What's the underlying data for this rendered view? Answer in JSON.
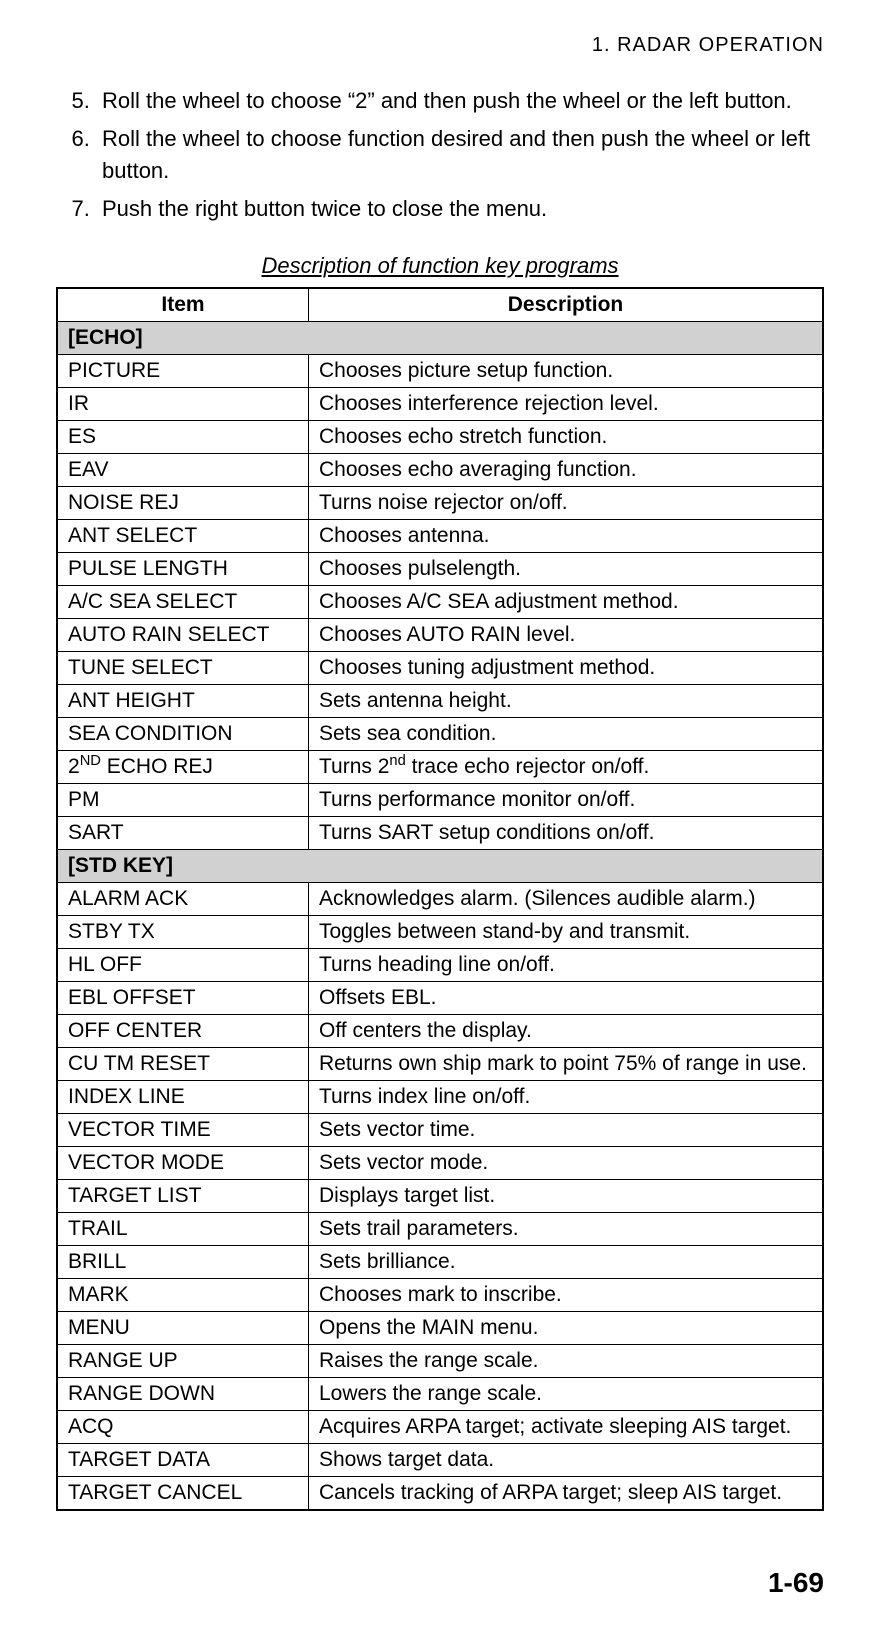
{
  "runningHead": "1.  RADAR  OPERATION",
  "steps": [
    "Roll the wheel to choose “2” and then push the wheel or the left button.",
    "Roll the wheel to choose function desired and then push the wheel or left button.",
    "Push the right button twice to close the menu."
  ],
  "stepStart": "5",
  "tableCaption": "Description of function key programs",
  "columns": {
    "item": "Item",
    "desc": "Description"
  },
  "sections": [
    {
      "category": "[ECHO]",
      "rows": [
        {
          "item": "PICTURE",
          "desc": "Chooses picture setup function."
        },
        {
          "item": "IR",
          "desc": "Chooses interference rejection level."
        },
        {
          "item": "ES",
          "desc": "Chooses echo stretch function."
        },
        {
          "item": "EAV",
          "desc": "Chooses echo averaging function."
        },
        {
          "item": "NOISE REJ",
          "desc": "Turns noise rejector on/off."
        },
        {
          "item": "ANT SELECT",
          "desc": "Chooses antenna."
        },
        {
          "item": "PULSE LENGTH",
          "desc": "Chooses pulselength."
        },
        {
          "item": "A/C SEA SELECT",
          "desc": "Chooses A/C SEA adjustment method."
        },
        {
          "item": "AUTO RAIN SELECT",
          "desc": "Chooses AUTO RAIN level."
        },
        {
          "item": "TUNE SELECT",
          "desc": "Chooses tuning adjustment method."
        },
        {
          "item": "ANT HEIGHT",
          "desc": "Sets antenna height."
        },
        {
          "item": "SEA CONDITION",
          "desc": "Sets sea condition."
        },
        {
          "item_html": "2<sup class=\"small\">ND</sup> ECHO REJ",
          "desc_html": "Turns 2<sup class=\"small\">nd</sup> trace echo rejector on/off."
        },
        {
          "item": "PM",
          "desc": "Turns performance monitor on/off."
        },
        {
          "item": "SART",
          "desc": "Turns SART setup conditions on/off."
        }
      ]
    },
    {
      "category": "[STD KEY]",
      "rows": [
        {
          "item": "ALARM ACK",
          "desc": "Acknowledges alarm. (Silences audible alarm.)"
        },
        {
          "item": "STBY TX",
          "desc": "Toggles between stand-by and transmit."
        },
        {
          "item": "HL OFF",
          "desc": "Turns heading line on/off."
        },
        {
          "item": "EBL OFFSET",
          "desc": "Offsets EBL."
        },
        {
          "item": "OFF CENTER",
          "desc": "Off centers the display."
        },
        {
          "item": "CU TM RESET",
          "desc": "Returns own ship mark to point 75% of range in use."
        },
        {
          "item": "INDEX LINE",
          "desc": "Turns index line on/off."
        },
        {
          "item": "VECTOR TIME",
          "desc": "Sets vector time."
        },
        {
          "item": "VECTOR MODE",
          "desc": "Sets vector mode."
        },
        {
          "item": "TARGET LIST",
          "desc": "Displays target list."
        },
        {
          "item": "TRAIL",
          "desc": "Sets trail parameters."
        },
        {
          "item": "BRILL",
          "desc": "Sets brilliance."
        },
        {
          "item": "MARK",
          "desc": "Chooses mark to inscribe."
        },
        {
          "item": "MENU",
          "desc": "Opens the MAIN menu."
        },
        {
          "item": "RANGE UP",
          "desc": "Raises the range scale."
        },
        {
          "item": "RANGE DOWN",
          "desc": "Lowers the range scale."
        },
        {
          "item": "ACQ",
          "desc": "Acquires ARPA target; activate sleeping AIS target."
        },
        {
          "item": "TARGET DATA",
          "desc": "Shows target data."
        },
        {
          "item": "TARGET CANCEL",
          "desc": "Cancels tracking of ARPA target; sleep AIS target."
        }
      ]
    }
  ],
  "pageNumber": "1-69"
}
